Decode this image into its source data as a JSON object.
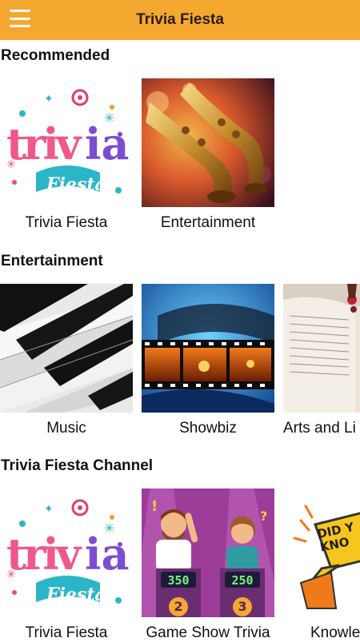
{
  "app": {
    "title": "Trivia Fiesta",
    "accent_color": "#f5a830",
    "menu_icon": "hamburger-menu-icon"
  },
  "sections": [
    {
      "title": "Recommended",
      "items": [
        {
          "label": "Trivia Fiesta",
          "thumb": "trivia-fiesta-logo"
        },
        {
          "label": "Entertainment",
          "thumb": "saxophone-photo"
        }
      ]
    },
    {
      "title": "Entertainment",
      "items": [
        {
          "label": "Music",
          "thumb": "piano-keys-photo"
        },
        {
          "label": "Showbiz",
          "thumb": "film-strip-photo"
        },
        {
          "label": "Arts and Li",
          "thumb": "open-book-photo"
        }
      ]
    },
    {
      "title": "Trivia Fiesta Channel",
      "items": [
        {
          "label": "Trivia Fiesta",
          "thumb": "trivia-fiesta-logo"
        },
        {
          "label": "Game Show Trivia",
          "thumb": "game-show-illustration",
          "scores": [
            "350",
            "250"
          ],
          "podium_numbers": [
            "2",
            "3"
          ]
        },
        {
          "label": "Knowle",
          "thumb": "did-you-know-illustration",
          "badge_text": "DID Y KNO"
        }
      ]
    }
  ]
}
